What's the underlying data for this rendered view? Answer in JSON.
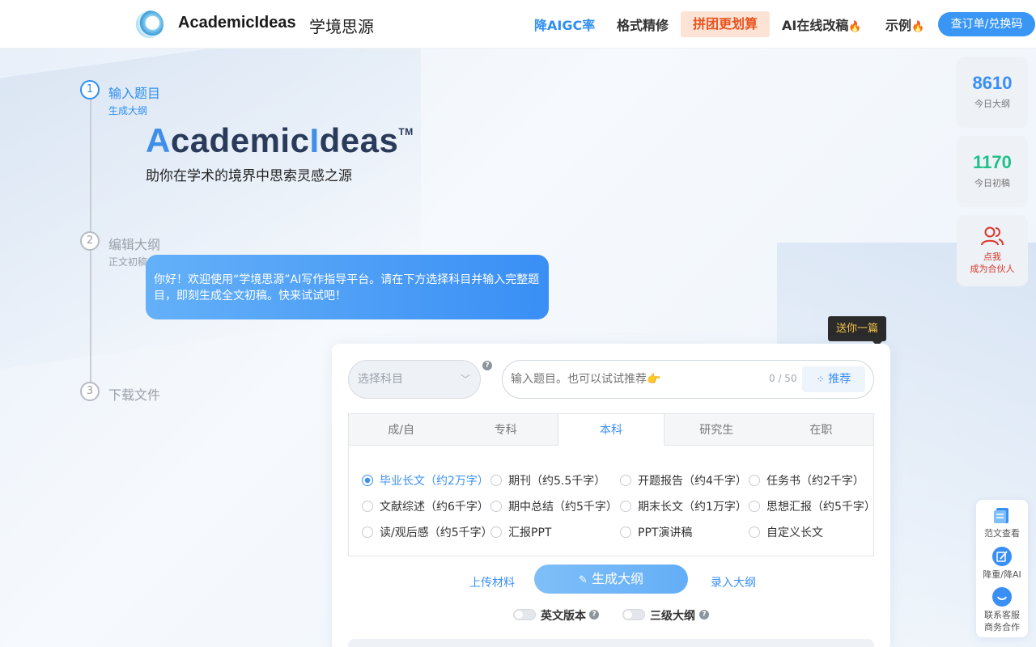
{
  "header": {
    "logo_text": "AcademicIdeas",
    "logo_cn": "学境思源",
    "nav": {
      "aigc": "降AIGC率",
      "format": "格式精修",
      "group": "拼团更划算",
      "ai_revise": "AI在线改稿",
      "example": "示例"
    },
    "order_button": "查订单/兑换码"
  },
  "steps": [
    {
      "num": "1",
      "title": "输入题目",
      "sub": "生成大纲"
    },
    {
      "num": "2",
      "title": "编辑大纲",
      "sub": "正文初稿"
    },
    {
      "num": "3",
      "title": "下载文件",
      "sub": ""
    }
  ],
  "hero": {
    "title_a": "A",
    "title_rest1": "cademic",
    "title_i": "I",
    "title_rest2": "deas",
    "tm": "TM",
    "subtitle": "助你在学术的境界中思索灵感之源"
  },
  "bubble": "你好！欢迎使用“学境思源”AI写作指导平台。请在下方选择科目并输入完整题目，即刻生成全文初稿。快来试试吧！",
  "gift": {
    "tip": "送你一篇"
  },
  "form": {
    "subject_placeholder": "选择科目",
    "topic_placeholder": "输入题目。也可以试试推荐👉",
    "topic_count": "0 / 50",
    "recommend_button": "推荐",
    "tabs": [
      "成/自",
      "专科",
      "本科",
      "研究生",
      "在职"
    ],
    "active_tab": "本科",
    "types": [
      "毕业长文（约2万字）",
      "期刊（约5.5千字）",
      "开题报告（约4千字）",
      "任务书（约2千字）",
      "文献综述（约6千字）",
      "期中总结（约5千字）",
      "期末长文（约1万字）",
      "思想汇报（约5千字）",
      "读/观后感（约5千字）",
      "汇报PPT",
      "PPT演讲稿",
      "自定义长文"
    ],
    "selected_type": "毕业长文（约2万字）",
    "upload_link": "上传材料",
    "generate_button": "生成大纲",
    "enter_link": "录入大纲",
    "toggle_english": "英文版本",
    "toggle_three_level": "三级大纲"
  },
  "stats": {
    "outlines_num": "8610",
    "outlines_label": "今日大纲",
    "drafts_num": "1170",
    "drafts_label": "今日初稿",
    "partner_line1": "点我",
    "partner_line2": "成为合伙人"
  },
  "float": {
    "sample": "范文查看",
    "reduce_line1": "降重/降AI",
    "service_line1": "联系客服",
    "service_line2": "商务合作"
  },
  "colors": {
    "accent": "#3a8ff5",
    "outlines_num": "#3a8ff5",
    "drafts_num": "#1fc08a",
    "partner": "#d9362b",
    "group_bg": "#fde3d6",
    "group_text": "#e8541e"
  }
}
